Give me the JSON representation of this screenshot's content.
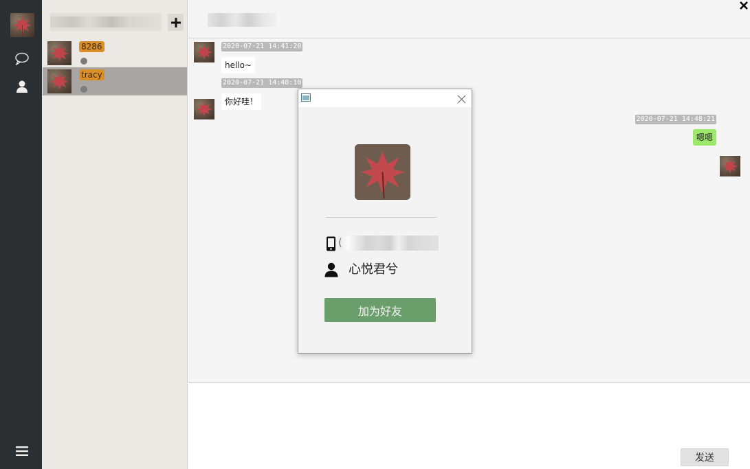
{
  "contacts": [
    {
      "name": "8286",
      "status": "offline",
      "selected": false
    },
    {
      "name": "tracy",
      "status": "offline",
      "selected": true
    }
  ],
  "messages": [
    {
      "side": "left",
      "time": "2020-07-21 14:41:20",
      "text": "hello~"
    },
    {
      "side": "left",
      "time": "2020-07-21 14:48:10",
      "text": "你好哇！"
    },
    {
      "side": "right",
      "time": "2020-07-21 14:48:21",
      "text": "嗯嗯"
    }
  ],
  "input": {
    "send_label": "发送",
    "value": ""
  },
  "profile_dialog": {
    "nickname": "心悦君兮",
    "phone_prefix": "(",
    "add_button_label": "加为好友"
  },
  "icons": {
    "sidebar": [
      "chat-bubble-icon",
      "user-icon",
      "menu-icon"
    ],
    "add": "plus-icon",
    "close": "close-icon",
    "phone": "phone-icon"
  },
  "colors": {
    "sidebar_bg": "#2b2f31",
    "contact_list_bg": "#ece9e5",
    "selected_contact_bg": "#a8a5a2",
    "name_badge": "#d98e2a",
    "my_bubble": "#9de86a",
    "add_friend_button": "#6a9e6a"
  }
}
